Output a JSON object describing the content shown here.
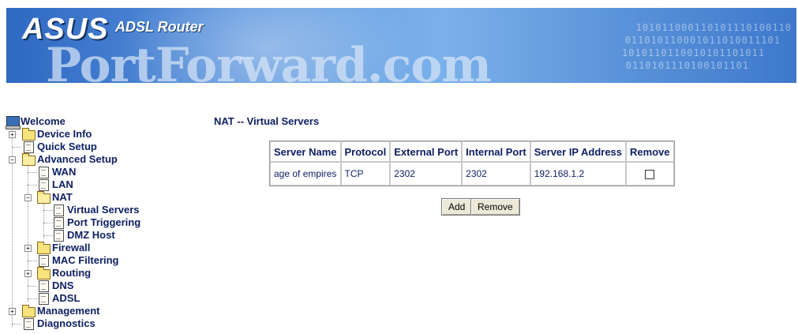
{
  "header": {
    "brand": "ASUS",
    "product": "ADSL Router",
    "watermark": "PortForward.com",
    "binary_lines": [
      "101011000110101110100110",
      "011010110001011010011101",
      "1010110110010101101011",
      "0110101110100101101"
    ]
  },
  "tree": {
    "items": [
      {
        "label": "Welcome",
        "icon": "computer-icon"
      },
      {
        "label": "Device Info",
        "icon": "folder-icon"
      },
      {
        "label": "Quick Setup",
        "icon": "page-icon"
      },
      {
        "label": "Advanced Setup",
        "icon": "folder-open-icon"
      },
      {
        "label": "WAN",
        "icon": "page-icon"
      },
      {
        "label": "LAN",
        "icon": "page-icon"
      },
      {
        "label": "NAT",
        "icon": "folder-open-icon"
      },
      {
        "label": "Virtual Servers",
        "icon": "page-icon"
      },
      {
        "label": "Port Triggering",
        "icon": "page-icon"
      },
      {
        "label": "DMZ Host",
        "icon": "page-icon"
      },
      {
        "label": "Firewall",
        "icon": "folder-icon"
      },
      {
        "label": "MAC Filtering",
        "icon": "page-icon"
      },
      {
        "label": "Routing",
        "icon": "folder-icon"
      },
      {
        "label": "DNS",
        "icon": "page-icon"
      },
      {
        "label": "ADSL",
        "icon": "page-icon"
      },
      {
        "label": "Management",
        "icon": "folder-icon"
      },
      {
        "label": "Diagnostics",
        "icon": "page-icon"
      }
    ]
  },
  "main": {
    "title": "NAT -- Virtual Servers",
    "table": {
      "headers": [
        "Server Name",
        "Protocol",
        "External Port",
        "Internal Port",
        "Server IP Address",
        "Remove"
      ],
      "rows": [
        {
          "server_name": "age of empires",
          "protocol": "TCP",
          "external_port": "2302",
          "internal_port": "2302",
          "server_ip": "192.168.1.2",
          "remove_checked": false
        }
      ]
    },
    "buttons": {
      "add": "Add",
      "remove": "Remove"
    }
  },
  "colors": {
    "text": "#0f2064",
    "banner_dark": "#2f68c2",
    "banner_light": "#7bb1ea",
    "button_face": "#ece9d8"
  }
}
